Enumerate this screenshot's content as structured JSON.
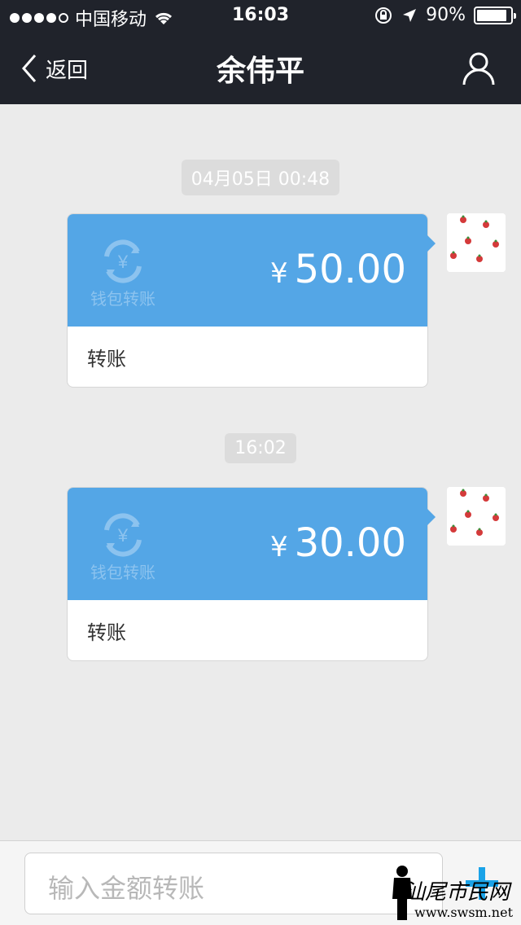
{
  "status_bar": {
    "carrier": "中国移动",
    "time": "16:03",
    "battery": "90%",
    "battery_fraction": 0.9,
    "icons": [
      "signal-dots-icon",
      "wifi-icon",
      "rotation-lock-icon",
      "location-icon",
      "battery-icon"
    ]
  },
  "nav": {
    "back_label": "返回",
    "title": "余伟平",
    "profile_icon": "profile-icon"
  },
  "chat": {
    "messages": [
      {
        "timestamp": "04月05日 00:48",
        "currency": "¥",
        "amount": "50.00",
        "wallet_label": "钱包转账",
        "type_label": "转账"
      },
      {
        "timestamp": "16:02",
        "currency": "¥",
        "amount": "30.00",
        "wallet_label": "钱包转账",
        "type_label": "转账"
      }
    ]
  },
  "input_bar": {
    "placeholder": "输入金额转账",
    "add_icon": "plus-icon"
  },
  "watermark": {
    "site": "www.swsm.net"
  },
  "colors": {
    "nav_bg": "#20232b",
    "card_blue": "#54a6e6",
    "page_bg": "#ebebeb",
    "accent": "#1aa3e8"
  }
}
